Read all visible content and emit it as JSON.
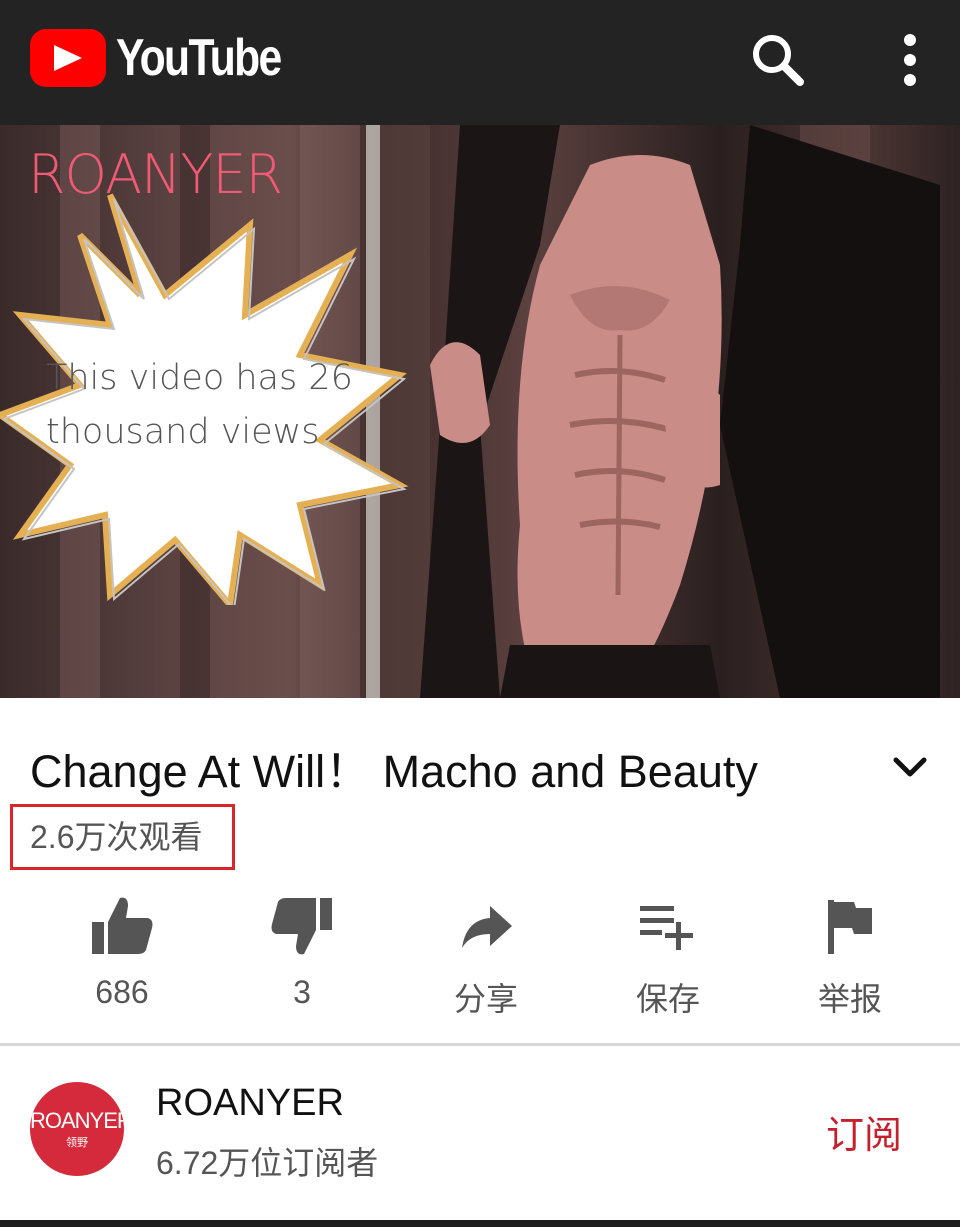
{
  "app": {
    "logo_text": "YouTube",
    "brand_color": "#ff0000"
  },
  "video": {
    "brand_overlay": "ROANYER",
    "callout_text": "This video has 26 thousand views"
  },
  "info": {
    "title": "Change At Will！ Macho and Beauty",
    "views": "2.6万次观看",
    "highlight_color": "#d9262a"
  },
  "actions": [
    {
      "icon": "thumbs-up-icon",
      "label": "686"
    },
    {
      "icon": "thumbs-down-icon",
      "label": "3"
    },
    {
      "icon": "share-icon",
      "label": "分享"
    },
    {
      "icon": "save-playlist-icon",
      "label": "保存"
    },
    {
      "icon": "flag-icon",
      "label": "举报"
    }
  ],
  "channel": {
    "avatar_text": "ROANYER",
    "avatar_subtext": "领野",
    "name": "ROANYER",
    "subscribers": "6.72万位订阅者",
    "subscribe_label": "订阅",
    "subscribe_color": "#c4202d"
  }
}
